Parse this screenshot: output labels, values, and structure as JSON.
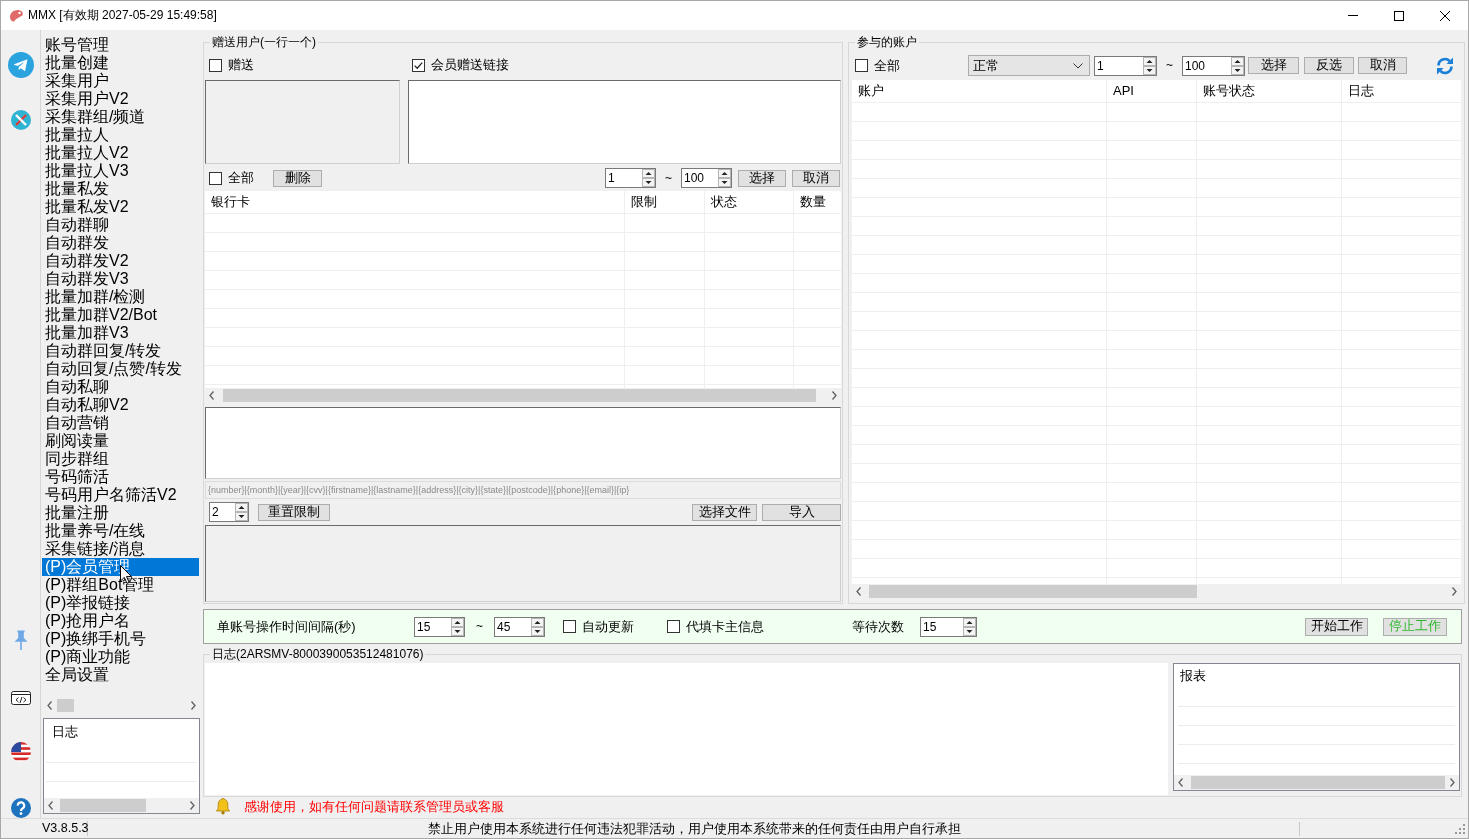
{
  "window": {
    "title": "MMX [有效期 2027-05-29 15:49:58]"
  },
  "sidebar": {
    "items": [
      {
        "label": "账号管理",
        "selected": false
      },
      {
        "label": "批量创建",
        "selected": false
      },
      {
        "label": "采集用户",
        "selected": false
      },
      {
        "label": "采集用户V2",
        "selected": false
      },
      {
        "label": "采集群组/频道",
        "selected": false
      },
      {
        "label": "批量拉人",
        "selected": false
      },
      {
        "label": "批量拉人V2",
        "selected": false
      },
      {
        "label": "批量拉人V3",
        "selected": false
      },
      {
        "label": "批量私发",
        "selected": false
      },
      {
        "label": "批量私发V2",
        "selected": false
      },
      {
        "label": "自动群聊",
        "selected": false
      },
      {
        "label": "自动群发",
        "selected": false
      },
      {
        "label": "自动群发V2",
        "selected": false
      },
      {
        "label": "自动群发V3",
        "selected": false
      },
      {
        "label": "批量加群/检测",
        "selected": false
      },
      {
        "label": "批量加群V2/Bot",
        "selected": false
      },
      {
        "label": "批量加群V3",
        "selected": false
      },
      {
        "label": "自动群回复/转发",
        "selected": false
      },
      {
        "label": "自动回复/点赞/转发",
        "selected": false
      },
      {
        "label": "自动私聊",
        "selected": false
      },
      {
        "label": "自动私聊V2",
        "selected": false
      },
      {
        "label": "自动营销",
        "selected": false
      },
      {
        "label": "刷阅读量",
        "selected": false
      },
      {
        "label": "同步群组",
        "selected": false
      },
      {
        "label": "号码筛活",
        "selected": false
      },
      {
        "label": "号码用户名筛活V2",
        "selected": false
      },
      {
        "label": "批量注册",
        "selected": false
      },
      {
        "label": "批量养号/在线",
        "selected": false
      },
      {
        "label": "采集链接/消息",
        "selected": false
      },
      {
        "label": "(P)会员管理",
        "selected": true
      },
      {
        "label": "(P)群组Bot管理",
        "selected": false
      },
      {
        "label": "(P)举报链接",
        "selected": false
      },
      {
        "label": "(P)抢用户名",
        "selected": false
      },
      {
        "label": "(P)换绑手机号",
        "selected": false
      },
      {
        "label": "(P)商业功能",
        "selected": false
      },
      {
        "label": "全局设置",
        "selected": false
      }
    ],
    "log_header": "日志"
  },
  "gift_panel": {
    "title": "赠送用户(一行一个)",
    "options": [
      {
        "label": "赠送",
        "checked": false
      },
      {
        "label": "会员赠送链接",
        "checked": true
      }
    ],
    "select_all": {
      "label": "全部",
      "checked": false
    },
    "delete_button": "删除",
    "range": {
      "from": "1",
      "separator": "~",
      "to": "100"
    },
    "range_buttons": [
      "选择",
      "取消"
    ],
    "table": {
      "columns": [
        "银行卡",
        "限制",
        "状态",
        "数量"
      ]
    },
    "template_hint": "{number}|{month}|{year}|{cvv}|{firstname}|{lastname}|{address}|{city}|{state}|{postcode}|{phone}|{email}|{ip}",
    "limit_value": "2",
    "reset_button": "重置限制",
    "file_buttons": [
      "选择文件",
      "导入"
    ]
  },
  "accounts_panel": {
    "title": "参与的账户",
    "select_all": {
      "label": "全部",
      "checked": false
    },
    "status_filter": "正常",
    "range": {
      "from": "1",
      "separator": "~",
      "to": "100"
    },
    "buttons": [
      "选择",
      "反选",
      "取消"
    ],
    "table": {
      "columns": [
        "账户",
        "API",
        "账号状态",
        "日志"
      ]
    }
  },
  "settings_bar": {
    "interval_label": "单账号操作时间间隔(秒)",
    "interval": {
      "from": "15",
      "separator": "~",
      "to": "45"
    },
    "options": [
      {
        "label": "自动更新",
        "checked": false
      },
      {
        "label": "代填卡主信息",
        "checked": false
      }
    ],
    "wait_label": "等待次数",
    "wait_value": "15",
    "buttons": [
      {
        "label": "开始工作",
        "color": "#000000"
      },
      {
        "label": "停止工作",
        "color": "#2eb82e"
      }
    ]
  },
  "log_panel": {
    "title": "日志(2ARSMV-8000390053512481076)",
    "report_header": "报表"
  },
  "notice": {
    "text": "感谢使用，如有任何问题请联系管理员或客服"
  },
  "status_bar": {
    "version": "V3.8.5.3",
    "message": "禁止用户使用本系统进行任何违法犯罪活动，用户使用本系统带来的任何责任由用户自行承担"
  }
}
